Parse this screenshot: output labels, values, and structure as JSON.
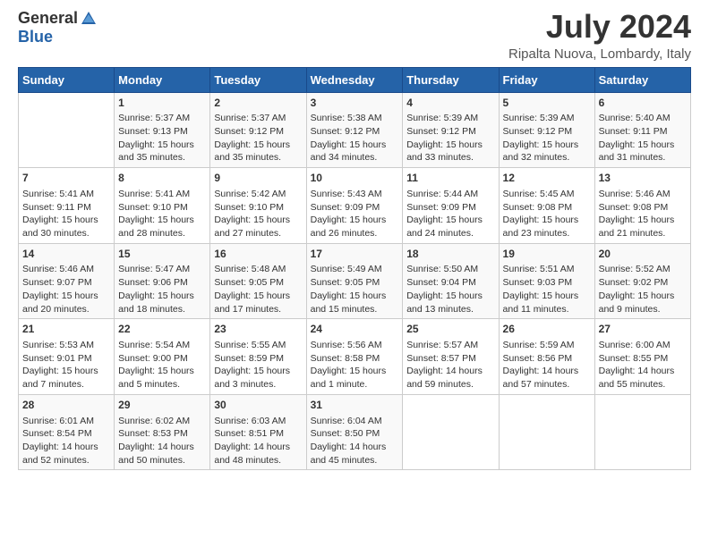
{
  "header": {
    "logo_general": "General",
    "logo_blue": "Blue",
    "month_title": "July 2024",
    "location": "Ripalta Nuova, Lombardy, Italy"
  },
  "calendar": {
    "days_of_week": [
      "Sunday",
      "Monday",
      "Tuesday",
      "Wednesday",
      "Thursday",
      "Friday",
      "Saturday"
    ],
    "weeks": [
      [
        {
          "day": "",
          "info": ""
        },
        {
          "day": "1",
          "info": "Sunrise: 5:37 AM\nSunset: 9:13 PM\nDaylight: 15 hours\nand 35 minutes."
        },
        {
          "day": "2",
          "info": "Sunrise: 5:37 AM\nSunset: 9:12 PM\nDaylight: 15 hours\nand 35 minutes."
        },
        {
          "day": "3",
          "info": "Sunrise: 5:38 AM\nSunset: 9:12 PM\nDaylight: 15 hours\nand 34 minutes."
        },
        {
          "day": "4",
          "info": "Sunrise: 5:39 AM\nSunset: 9:12 PM\nDaylight: 15 hours\nand 33 minutes."
        },
        {
          "day": "5",
          "info": "Sunrise: 5:39 AM\nSunset: 9:12 PM\nDaylight: 15 hours\nand 32 minutes."
        },
        {
          "day": "6",
          "info": "Sunrise: 5:40 AM\nSunset: 9:11 PM\nDaylight: 15 hours\nand 31 minutes."
        }
      ],
      [
        {
          "day": "7",
          "info": "Sunrise: 5:41 AM\nSunset: 9:11 PM\nDaylight: 15 hours\nand 30 minutes."
        },
        {
          "day": "8",
          "info": "Sunrise: 5:41 AM\nSunset: 9:10 PM\nDaylight: 15 hours\nand 28 minutes."
        },
        {
          "day": "9",
          "info": "Sunrise: 5:42 AM\nSunset: 9:10 PM\nDaylight: 15 hours\nand 27 minutes."
        },
        {
          "day": "10",
          "info": "Sunrise: 5:43 AM\nSunset: 9:09 PM\nDaylight: 15 hours\nand 26 minutes."
        },
        {
          "day": "11",
          "info": "Sunrise: 5:44 AM\nSunset: 9:09 PM\nDaylight: 15 hours\nand 24 minutes."
        },
        {
          "day": "12",
          "info": "Sunrise: 5:45 AM\nSunset: 9:08 PM\nDaylight: 15 hours\nand 23 minutes."
        },
        {
          "day": "13",
          "info": "Sunrise: 5:46 AM\nSunset: 9:08 PM\nDaylight: 15 hours\nand 21 minutes."
        }
      ],
      [
        {
          "day": "14",
          "info": "Sunrise: 5:46 AM\nSunset: 9:07 PM\nDaylight: 15 hours\nand 20 minutes."
        },
        {
          "day": "15",
          "info": "Sunrise: 5:47 AM\nSunset: 9:06 PM\nDaylight: 15 hours\nand 18 minutes."
        },
        {
          "day": "16",
          "info": "Sunrise: 5:48 AM\nSunset: 9:05 PM\nDaylight: 15 hours\nand 17 minutes."
        },
        {
          "day": "17",
          "info": "Sunrise: 5:49 AM\nSunset: 9:05 PM\nDaylight: 15 hours\nand 15 minutes."
        },
        {
          "day": "18",
          "info": "Sunrise: 5:50 AM\nSunset: 9:04 PM\nDaylight: 15 hours\nand 13 minutes."
        },
        {
          "day": "19",
          "info": "Sunrise: 5:51 AM\nSunset: 9:03 PM\nDaylight: 15 hours\nand 11 minutes."
        },
        {
          "day": "20",
          "info": "Sunrise: 5:52 AM\nSunset: 9:02 PM\nDaylight: 15 hours\nand 9 minutes."
        }
      ],
      [
        {
          "day": "21",
          "info": "Sunrise: 5:53 AM\nSunset: 9:01 PM\nDaylight: 15 hours\nand 7 minutes."
        },
        {
          "day": "22",
          "info": "Sunrise: 5:54 AM\nSunset: 9:00 PM\nDaylight: 15 hours\nand 5 minutes."
        },
        {
          "day": "23",
          "info": "Sunrise: 5:55 AM\nSunset: 8:59 PM\nDaylight: 15 hours\nand 3 minutes."
        },
        {
          "day": "24",
          "info": "Sunrise: 5:56 AM\nSunset: 8:58 PM\nDaylight: 15 hours\nand 1 minute."
        },
        {
          "day": "25",
          "info": "Sunrise: 5:57 AM\nSunset: 8:57 PM\nDaylight: 14 hours\nand 59 minutes."
        },
        {
          "day": "26",
          "info": "Sunrise: 5:59 AM\nSunset: 8:56 PM\nDaylight: 14 hours\nand 57 minutes."
        },
        {
          "day": "27",
          "info": "Sunrise: 6:00 AM\nSunset: 8:55 PM\nDaylight: 14 hours\nand 55 minutes."
        }
      ],
      [
        {
          "day": "28",
          "info": "Sunrise: 6:01 AM\nSunset: 8:54 PM\nDaylight: 14 hours\nand 52 minutes."
        },
        {
          "day": "29",
          "info": "Sunrise: 6:02 AM\nSunset: 8:53 PM\nDaylight: 14 hours\nand 50 minutes."
        },
        {
          "day": "30",
          "info": "Sunrise: 6:03 AM\nSunset: 8:51 PM\nDaylight: 14 hours\nand 48 minutes."
        },
        {
          "day": "31",
          "info": "Sunrise: 6:04 AM\nSunset: 8:50 PM\nDaylight: 14 hours\nand 45 minutes."
        },
        {
          "day": "",
          "info": ""
        },
        {
          "day": "",
          "info": ""
        },
        {
          "day": "",
          "info": ""
        }
      ]
    ]
  }
}
